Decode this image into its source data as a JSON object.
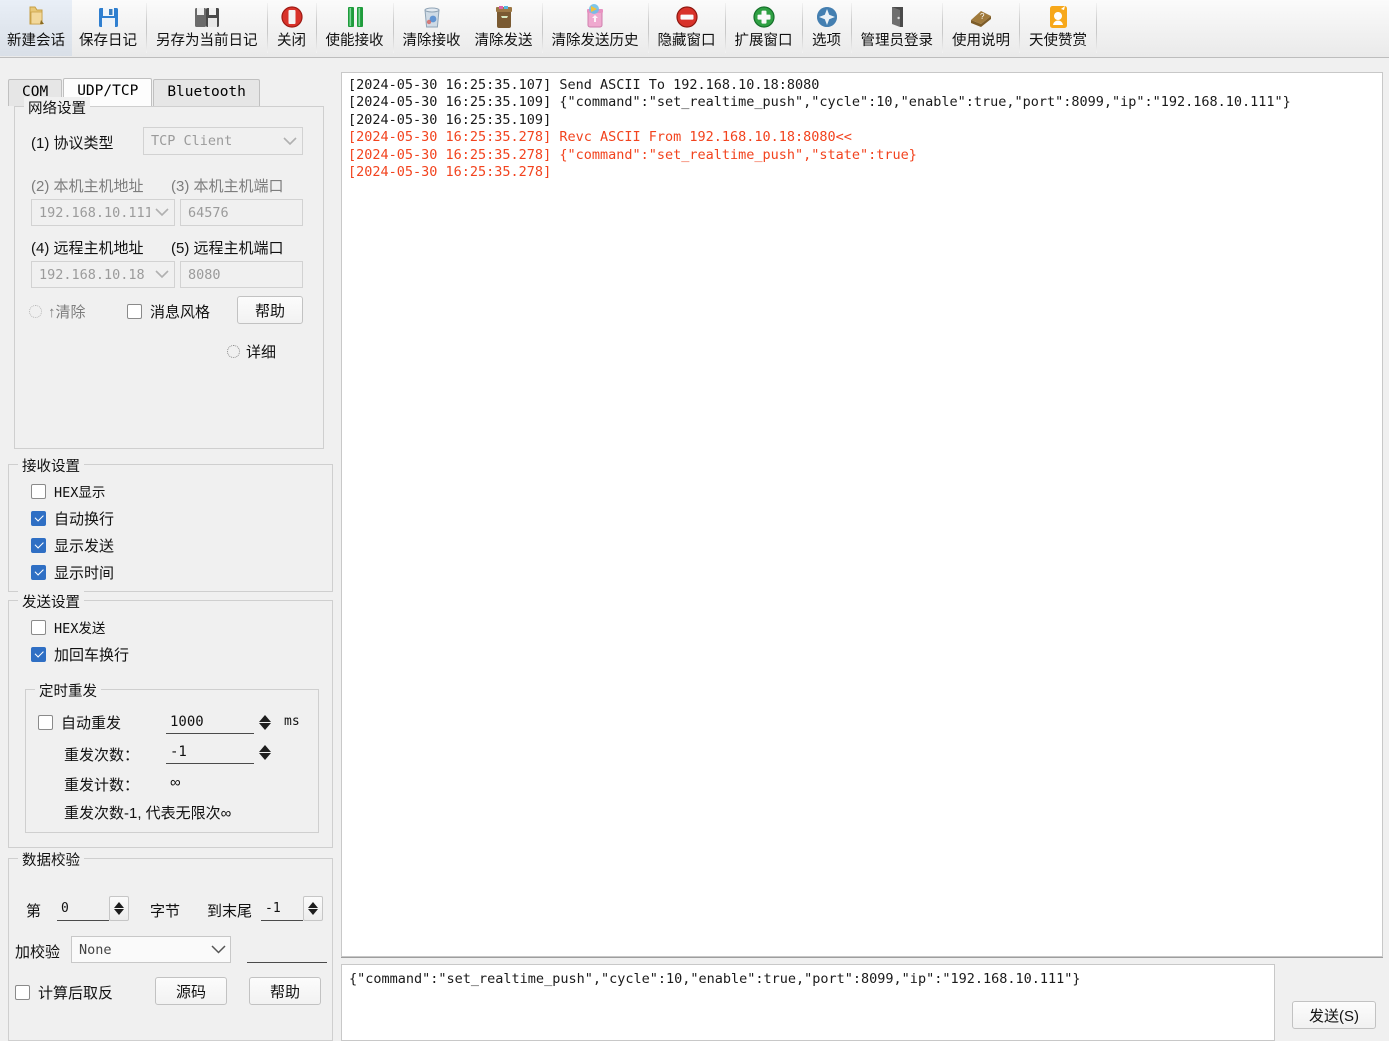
{
  "toolbar": {
    "items": [
      {
        "label": "新建会话",
        "icon": "new-session-icon"
      },
      {
        "label": "保存日记",
        "icon": "save-log-icon"
      },
      {
        "label": "另存为当前日记",
        "icon": "save-as-log-icon"
      },
      {
        "label": "关闭",
        "icon": "close-icon"
      },
      {
        "label": "使能接收",
        "icon": "pause-receive-icon"
      },
      {
        "label": "清除接收",
        "icon": "clear-receive-icon"
      },
      {
        "label": "清除发送",
        "icon": "clear-send-icon"
      },
      {
        "label": "清除发送历史",
        "icon": "clear-send-history-icon"
      },
      {
        "label": "隐藏窗口",
        "icon": "hide-window-icon"
      },
      {
        "label": "扩展窗口",
        "icon": "expand-window-icon"
      },
      {
        "label": "选项",
        "icon": "options-icon"
      },
      {
        "label": "管理员登录",
        "icon": "admin-login-icon"
      },
      {
        "label": "使用说明",
        "icon": "manual-icon"
      },
      {
        "label": "天使赞赏",
        "icon": "donate-icon"
      }
    ]
  },
  "tabs": [
    {
      "label": "COM",
      "active": false
    },
    {
      "label": "UDP/TCP",
      "active": true
    },
    {
      "label": "Bluetooth",
      "active": false
    }
  ],
  "network": {
    "group_title": "网络设置",
    "protocol_label": "(1) 协议类型",
    "protocol_value": "TCP Client",
    "local_host_label": "(2) 本机主机地址",
    "local_port_label": "(3) 本机主机端口",
    "local_host_value": "192.168.10.111",
    "local_port_value": "64576",
    "remote_host_label": "(4) 远程主机地址",
    "remote_port_label": "(5) 远程主机端口",
    "remote_host_value": "192.168.10.18",
    "remote_port_value": "8080",
    "clear_radio_label": "↑清除",
    "msg_style_label": "消息风格",
    "msg_style_checked": false,
    "help_button": "帮助",
    "detail_radio_label": "详细"
  },
  "receive": {
    "group_title": "接收设置",
    "options": [
      {
        "label": "HEX显示",
        "checked": false,
        "mono": true
      },
      {
        "label": "自动换行",
        "checked": true,
        "mono": false
      },
      {
        "label": "显示发送",
        "checked": true,
        "mono": false
      },
      {
        "label": "显示时间",
        "checked": true,
        "mono": false
      }
    ]
  },
  "send_settings": {
    "group_title": "发送设置",
    "options": [
      {
        "label": "HEX发送",
        "checked": false,
        "mono": true
      },
      {
        "label": "加回车换行",
        "checked": true,
        "mono": false
      }
    ],
    "timer_group_title": "定时重发",
    "auto_resend_label": "自动重发",
    "auto_resend_checked": false,
    "interval_value": "1000",
    "interval_unit": "ms",
    "resend_count_label": "重发次数：",
    "resend_count_value": "-1",
    "resend_counter_label": "重发计数：",
    "resend_counter_value": "∞",
    "hint": "重发次数-1, 代表无限次∞"
  },
  "checksum": {
    "group_title": "数据校验",
    "from_label": "第",
    "from_value": "0",
    "byte_label": "字节",
    "to_end_label": "到末尾",
    "to_end_value": "-1",
    "add_check_label": "加校验",
    "add_check_value": "None",
    "result_value": "",
    "invert_label": "计算后取反",
    "invert_checked": false,
    "source_button": "源码",
    "help_button": "帮助"
  },
  "log": {
    "lines": [
      {
        "text": "[2024-05-30 16:25:35.107] Send ASCII To 192.168.10.18:8080",
        "kind": "tx"
      },
      {
        "text": "[2024-05-30 16:25:35.109] {\"command\":\"set_realtime_push\",\"cycle\":10,\"enable\":true,\"port\":8099,\"ip\":\"192.168.10.111\"}",
        "kind": "tx"
      },
      {
        "text": "[2024-05-30 16:25:35.109]",
        "kind": "tx"
      },
      {
        "text": "[2024-05-30 16:25:35.278] Revc ASCII From 192.168.10.18:8080<<",
        "kind": "rx"
      },
      {
        "text": "[2024-05-30 16:25:35.278] {\"command\":\"set_realtime_push\",\"state\":true}",
        "kind": "rx"
      },
      {
        "text": "[2024-05-30 16:25:35.278]",
        "kind": "rx"
      }
    ]
  },
  "send_area": {
    "text": "{\"command\":\"set_realtime_push\",\"cycle\":10,\"enable\":true,\"port\":8099,\"ip\":\"192.168.10.111\"}",
    "send_button": "发送(S)"
  },
  "colors": {
    "rx_red": "#f2431e",
    "checkbox_blue": "#2f6fc4",
    "panel_bg": "#f0f0f0"
  }
}
